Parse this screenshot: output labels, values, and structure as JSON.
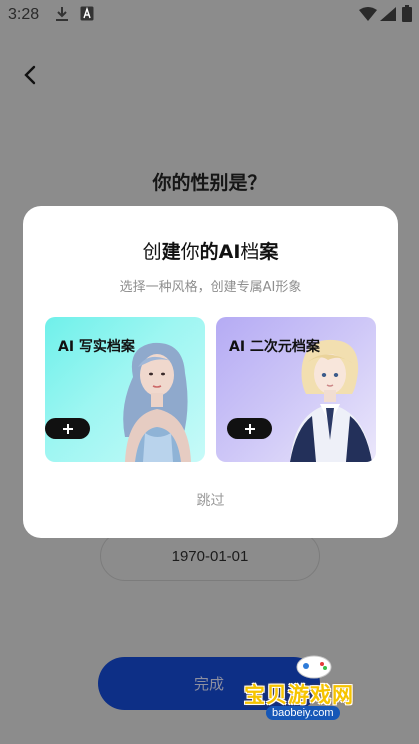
{
  "status_bar": {
    "time": "3:28",
    "icons": [
      "download-icon",
      "a-icon",
      "wifi-icon",
      "signal-icon",
      "battery-icon"
    ]
  },
  "page": {
    "title": "你的性别是？",
    "date_value": "1970-01-01",
    "done_label": "完成"
  },
  "modal": {
    "title_parts": [
      "创",
      "建",
      "你",
      "的",
      "AI",
      "档",
      "案"
    ],
    "subtitle": "选择一种风格，创建专属AI形象",
    "cards": [
      {
        "label": "AI 写实档案",
        "color": "#6ff0ea"
      },
      {
        "label": "AI 二次元档案",
        "color": "#b5abf4"
      }
    ],
    "skip_label": "跳过"
  },
  "watermark": {
    "text": "宝贝游戏网",
    "url": "baobeiy.com"
  },
  "colors": {
    "overlay": "#8c8c8c",
    "primary_button": "#0d2f86",
    "modal_bg": "#ffffff"
  }
}
